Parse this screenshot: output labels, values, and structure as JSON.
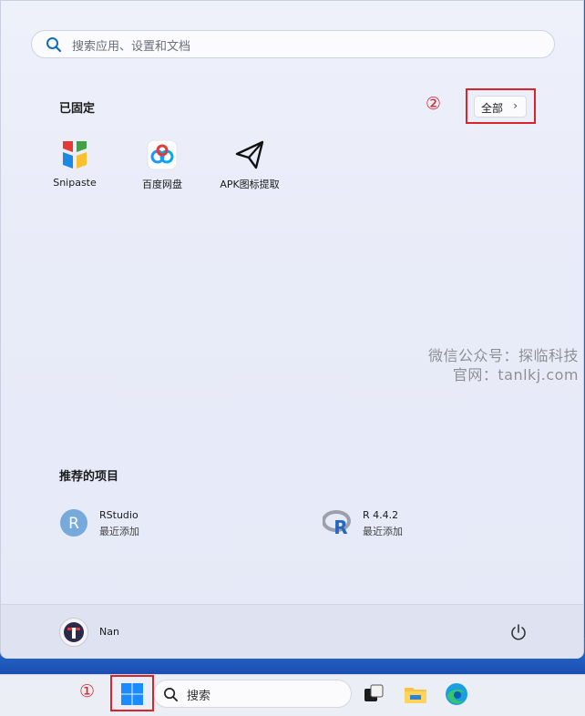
{
  "search": {
    "placeholder": "搜索应用、设置和文档"
  },
  "pinned": {
    "title": "已固定",
    "all_button": "全部",
    "apps": [
      {
        "name": "Snipaste",
        "icon": "snipaste-icon"
      },
      {
        "name": "百度网盘",
        "icon": "baidu-netdisk-icon"
      },
      {
        "name": "APK图标提取",
        "icon": "paper-plane-icon"
      }
    ]
  },
  "watermark": {
    "line1": "微信公众号：探临科技",
    "line2": "官网：tanlkj.com"
  },
  "recommended": {
    "title": "推荐的项目",
    "items": [
      {
        "name": "RStudio",
        "sub": "最近添加",
        "icon": "rstudio-icon"
      },
      {
        "name": "R 4.4.2",
        "sub": "最近添加",
        "icon": "r-icon"
      }
    ]
  },
  "user": {
    "name": "Nan"
  },
  "taskbar": {
    "search_label": "搜索"
  },
  "annotations": {
    "marker1": "①",
    "marker2": "②"
  },
  "colors": {
    "annotation_red": "#d9242b",
    "accent_blue": "#1a73e8"
  }
}
